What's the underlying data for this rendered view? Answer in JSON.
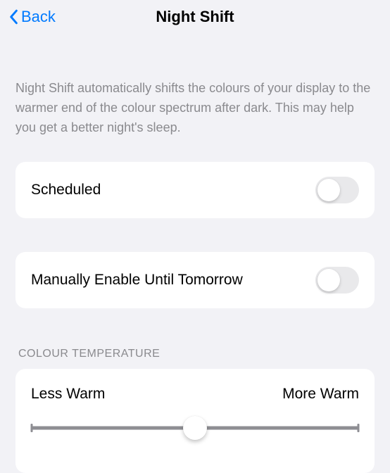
{
  "header": {
    "back_label": "Back",
    "title": "Night Shift"
  },
  "description": "Night Shift automatically shifts the colours of your display to the warmer end of the colour spectrum after dark. This may help you get a better night's sleep.",
  "rows": {
    "scheduled": {
      "label": "Scheduled",
      "on": false
    },
    "manual": {
      "label": "Manually Enable Until Tomorrow",
      "on": false
    }
  },
  "temperature": {
    "section_header": "COLOUR TEMPERATURE",
    "less_label": "Less Warm",
    "more_label": "More Warm",
    "value_percent": 50
  }
}
